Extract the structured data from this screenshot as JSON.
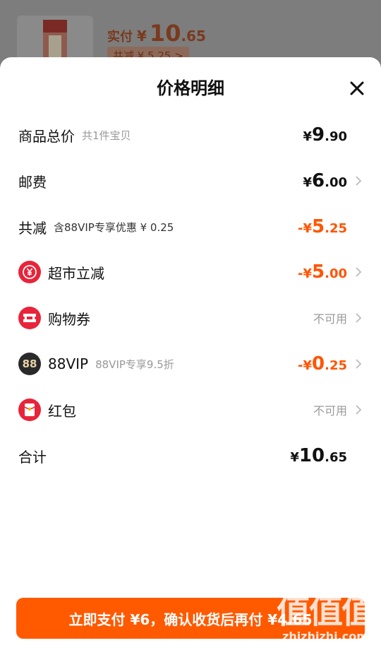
{
  "background_order": {
    "paid_label": "实付",
    "paid_currency": "¥",
    "paid_int": "10",
    "paid_dec": ".65",
    "reduce_text": "共减 ¥ 5.25 >"
  },
  "sheet": {
    "title": "价格明细",
    "close_icon": "close-icon"
  },
  "rows": {
    "total_goods": {
      "name": "商品总价",
      "sub": "共1件宝贝",
      "currency": "¥",
      "int": "9",
      "dec": ".90"
    },
    "shipping": {
      "name": "邮费",
      "currency": "¥",
      "int": "6",
      "dec": ".00"
    },
    "total_discount": {
      "name": "共减",
      "sub": "含88VIP专享优惠 ¥ 0.25",
      "currency": "-¥",
      "int": "5",
      "dec": ".25"
    },
    "supermarket": {
      "name": "超市立减",
      "currency": "-¥",
      "int": "5",
      "dec": ".00",
      "icon": "yuan-coin-icon"
    },
    "coupon": {
      "name": "购物券",
      "value": "不可用",
      "icon": "ticket-icon"
    },
    "vip": {
      "name": "88VIP",
      "sub": "88VIP专享9.5折",
      "currency": "-¥",
      "int": "0",
      "dec": ".25",
      "icon": "88vip-icon",
      "icon_text": "88"
    },
    "red_packet": {
      "name": "红包",
      "value": "不可用",
      "icon": "red-packet-icon"
    },
    "sum": {
      "name": "合计",
      "currency": "¥",
      "int": "10",
      "dec": ".65"
    }
  },
  "pay_button": {
    "label": "立即支付 ¥6，确认收货后再付 ¥4.65"
  },
  "watermark": {
    "big": "值值值",
    "small": "zhizhizhi.com"
  },
  "colors": {
    "accent": "#ff5500",
    "button": "#ff5a00",
    "icon_red": "#e8243a",
    "vip_dark": "#2a2a2a"
  }
}
